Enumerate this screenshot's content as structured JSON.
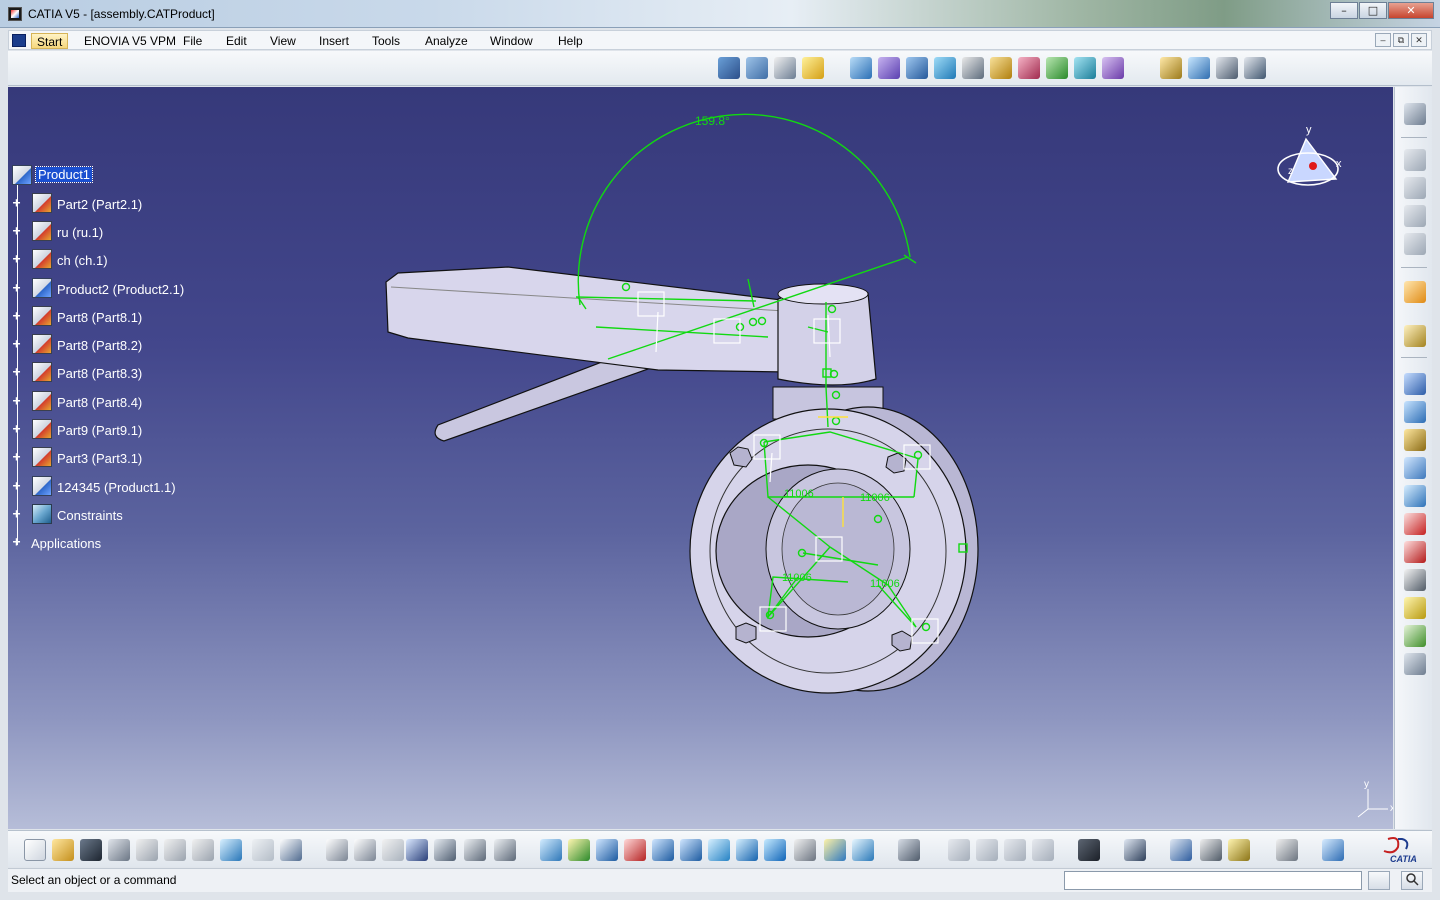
{
  "window": {
    "title": "CATIA V5 - [assembly.CATProduct]",
    "minimize": "–",
    "maximize": "□",
    "close": "✕"
  },
  "menubar": {
    "items": [
      "Start",
      "ENOVIA V5 VPM",
      "File",
      "Edit",
      "View",
      "Insert",
      "Tools",
      "Analyze",
      "Window",
      "Help"
    ],
    "mdi_minimize": "–",
    "mdi_restore": "⧉",
    "mdi_close": "✕"
  },
  "tree": {
    "root": "Product1",
    "items": [
      {
        "label": "Part2 (Part2.1)",
        "icon": "part-icon"
      },
      {
        "label": "ru (ru.1)",
        "icon": "part-icon"
      },
      {
        "label": "ch (ch.1)",
        "icon": "part-icon"
      },
      {
        "label": "Product2 (Product2.1)",
        "icon": "product-icon"
      },
      {
        "label": "Part8 (Part8.1)",
        "icon": "part-icon"
      },
      {
        "label": "Part8 (Part8.2)",
        "icon": "part-icon"
      },
      {
        "label": "Part8 (Part8.3)",
        "icon": "part-icon"
      },
      {
        "label": "Part8 (Part8.4)",
        "icon": "part-icon"
      },
      {
        "label": "Part9 (Part9.1)",
        "icon": "part-icon"
      },
      {
        "label": "Part3 (Part3.1)",
        "icon": "part-icon"
      },
      {
        "label": "124345 (Product1.1)",
        "icon": "product-icon"
      },
      {
        "label": "Constraints",
        "icon": "constraints-icon"
      },
      {
        "label": "Applications",
        "icon": "none"
      }
    ]
  },
  "viewport": {
    "angle_dimension": "159.8°",
    "dim_labels": [
      "11006",
      "11006",
      "11006",
      "11006"
    ],
    "compass_x": "x",
    "compass_y": "y",
    "compass_z": "z",
    "axis_x": "x",
    "axis_y": "y",
    "logo": "CATIA"
  },
  "status": {
    "message": "Select an object or a command",
    "command_value": "",
    "command_placeholder": ""
  },
  "colors": {
    "accent_green": "#11d911",
    "background_top": "#36397a",
    "background_bottom": "#b6bdd8",
    "selection": "#1a4fd0"
  }
}
